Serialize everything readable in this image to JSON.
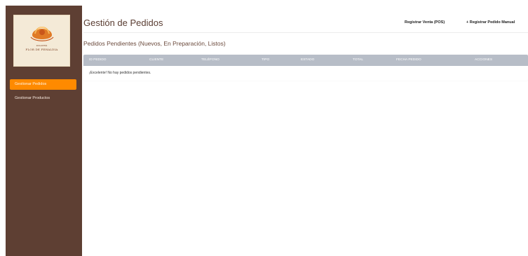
{
  "logo": {
    "brand_name": "FLOR DE PEHALDIA",
    "brand_small": "PANADERÍA"
  },
  "sidebar": {
    "items": [
      {
        "label": "Gestionar Pedidos",
        "active": true
      },
      {
        "label": "Gestionar Productos",
        "active": false
      }
    ]
  },
  "header": {
    "title": "Gestión de Pedidos",
    "actions": [
      {
        "label": "Registrar Venta (POS)"
      },
      {
        "label": "+ Registrar Pedido Manual"
      }
    ]
  },
  "section": {
    "title": "Pedidos Pendientes (Nuevos, En Preparación, Listos)"
  },
  "table": {
    "columns": [
      "ID PEDIDO",
      "CLIENTE",
      "TELÉFONO",
      "TIPO",
      "ESTADO",
      "TOTAL",
      "FECHA PEDIDO",
      "ACCIONES"
    ],
    "empty_message": "¡Excelente! No hay pedidos pendientes."
  },
  "colors": {
    "sidebar_bg": "#5e3f33",
    "active_item": "#ff8a00",
    "table_header": "#b7bdc7",
    "title_text": "#5a3d32"
  }
}
